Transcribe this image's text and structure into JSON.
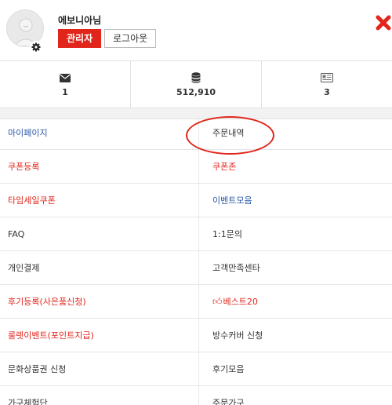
{
  "profile": {
    "username": "에보니아님",
    "admin_label": "관리자",
    "logout_label": "로그아웃"
  },
  "stats": [
    {
      "icon": "envelope-icon",
      "value": "1"
    },
    {
      "icon": "coins-icon",
      "value": "512,910"
    },
    {
      "icon": "coupon-icon",
      "value": "3"
    }
  ],
  "menu": [
    {
      "label": "마이페이지",
      "color": "#2b59a8"
    },
    {
      "label": "주문내역",
      "color": "#333333"
    },
    {
      "label": "쿠폰등록",
      "color": "#e1251b"
    },
    {
      "label": "쿠폰존",
      "color": "#e1251b"
    },
    {
      "label": "타임세일쿠폰",
      "color": "#e1251b"
    },
    {
      "label": "이벤트모음",
      "color": "#2b59a8"
    },
    {
      "label": "FAQ",
      "color": "#333333"
    },
    {
      "label": "1:1문의",
      "color": "#333333"
    },
    {
      "label": "개인결제",
      "color": "#333333"
    },
    {
      "label": "고객만족센타",
      "color": "#333333"
    },
    {
      "label": "후기등록(사은품신청)",
      "color": "#e1251b"
    },
    {
      "label": "베스트20",
      "color": "#e1251b",
      "icon": "thumbs-up-icon"
    },
    {
      "label": "룰렛이벤트(포인트지급)",
      "color": "#e1251b"
    },
    {
      "label": "방수커버 신청",
      "color": "#333333"
    },
    {
      "label": "문화상품권 신청",
      "color": "#333333"
    },
    {
      "label": "후기모음",
      "color": "#333333"
    },
    {
      "label": "가구체험단",
      "color": "#333333"
    },
    {
      "label": "주문가구",
      "color": "#333333"
    }
  ],
  "colors": {
    "accent": "#e1251b",
    "link": "#2b59a8"
  }
}
